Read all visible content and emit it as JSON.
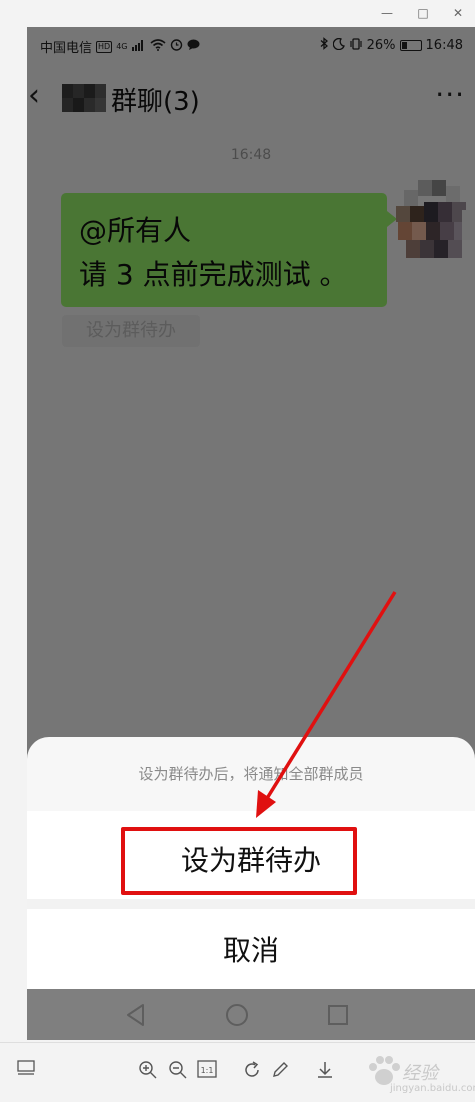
{
  "status_bar": {
    "carrier": "中国电信",
    "hd_badge": "HD",
    "network": "4G",
    "battery": "26%",
    "time": "16:48"
  },
  "chat_header": {
    "back_icon": "chevron-left-icon",
    "title": "群聊(3)",
    "more": "···"
  },
  "chat": {
    "timestamp": "16:48",
    "message_line1": "@所有人",
    "message_line2": "请 3 点前完成测试 。",
    "todo_tag": "设为群待办"
  },
  "action_sheet": {
    "hint": "设为群待办后，将通知全部群成员",
    "confirm_label": "设为群待办",
    "cancel_label": "取消"
  },
  "colors": {
    "bubble": "#95ec69",
    "highlight": "#e01010",
    "overlay": "rgba(0,0,0,0.5)"
  },
  "watermark": {
    "text": "经验",
    "sub": "jingyan.baidu.com"
  }
}
